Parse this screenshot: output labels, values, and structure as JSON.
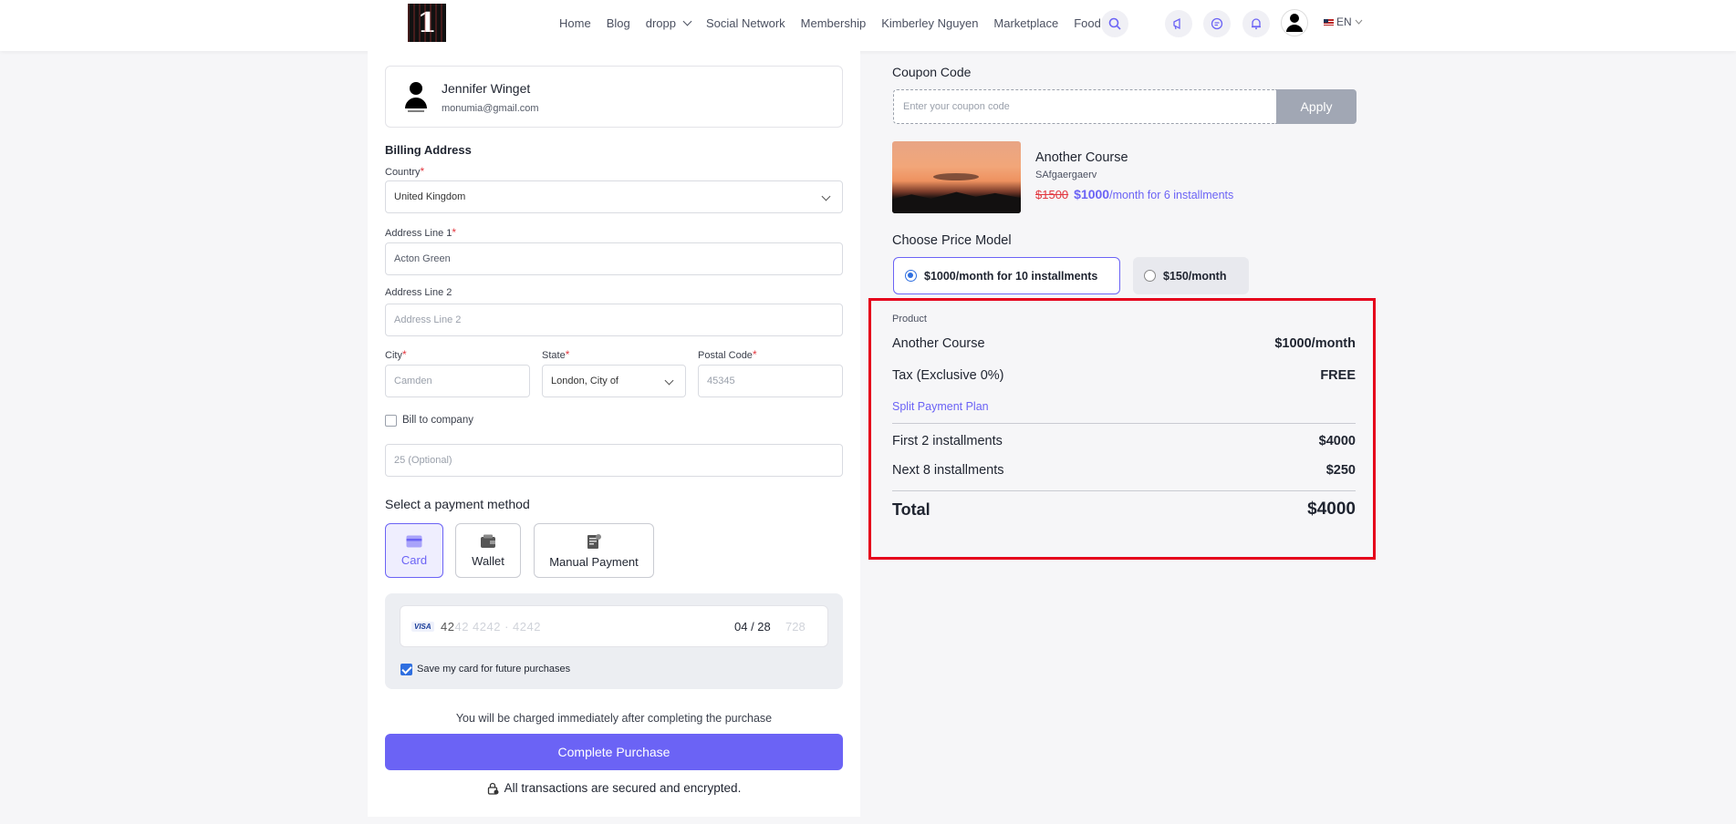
{
  "nav": {
    "items": [
      "Home",
      "Blog",
      "dropp",
      "Social Network",
      "Membership",
      "Kimberley Nguyen",
      "Marketplace",
      "Food"
    ],
    "lang": "EN",
    "logo_text": "1"
  },
  "user": {
    "name": "Jennifer Winget",
    "email": "monumia@gmail.com"
  },
  "billing": {
    "title": "Billing Address",
    "country_label": "Country",
    "country_value": "United Kingdom",
    "address1_label": "Address Line 1",
    "address1_value": "Acton Green",
    "address2_label": "Address Line 2",
    "address2_placeholder": "Address Line 2",
    "city_label": "City",
    "city_value": "Camden",
    "state_label": "State",
    "state_value": "London, City of",
    "postal_label": "Postal Code",
    "postal_value": "45345",
    "bill_company_label": "Bill to company",
    "company_placeholder": "25 (Optional)",
    "required_mark": "*"
  },
  "payment": {
    "title": "Select a payment method",
    "methods": [
      "Card",
      "Wallet",
      "Manual Payment"
    ],
    "card_brand": "VISA",
    "card_number_shown": "42",
    "card_number_faded": "42 4242 · 4242",
    "card_expiry": "04 / 28",
    "card_cvc": "728",
    "save_card_label": "Save my card for future purchases"
  },
  "checkout": {
    "charge_note": "You will be charged immediately after completing the purchase",
    "complete_button": "Complete Purchase",
    "secure_note": "All transactions are secured and encrypted."
  },
  "coupon": {
    "title": "Coupon Code",
    "placeholder": "Enter your coupon code",
    "apply_button": "Apply"
  },
  "course": {
    "title": "Another Course",
    "subtitle": "SAfgaergaerv",
    "old_price": "$1500",
    "new_price": "$1000",
    "price_suffix": "/month for 6 installments"
  },
  "price_model": {
    "title": "Choose Price Model",
    "options": [
      "$1000/month for 10 installments",
      "$150/month"
    ],
    "selected_index": 0
  },
  "summary": {
    "product_label": "Product",
    "product_name": "Another Course",
    "product_price": "$1000/month",
    "tax_label": "Tax (Exclusive 0%)",
    "tax_value": "FREE",
    "split_label": "Split Payment Plan",
    "first_label": "First 2 installments",
    "first_value": "$4000",
    "next_label": "Next 8 installments",
    "next_value": "$250",
    "total_label": "Total",
    "total_value": "$4000"
  },
  "colors": {
    "accent": "#6b63f5",
    "highlight_border": "#e5001b",
    "strike_price": "#e2373f"
  }
}
